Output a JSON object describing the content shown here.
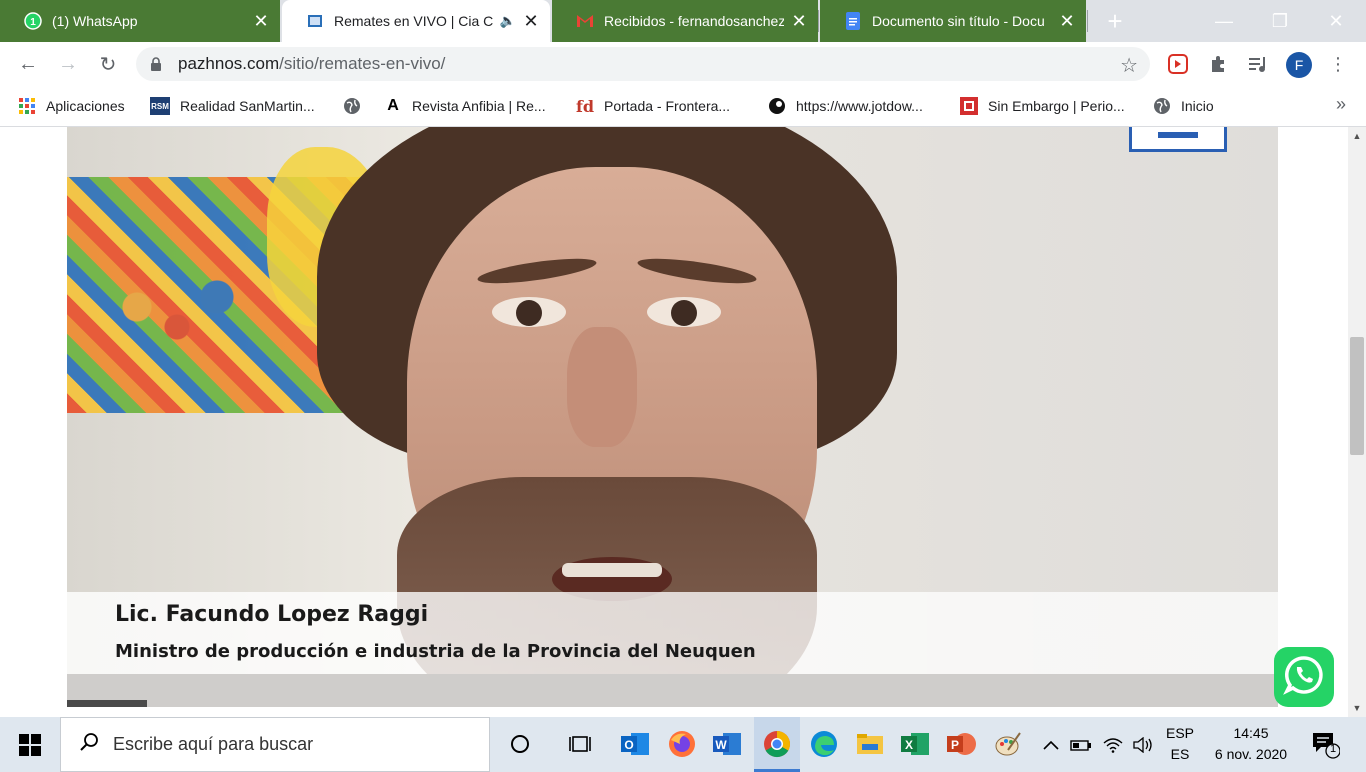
{
  "tabs": [
    {
      "title": "(1) WhatsApp",
      "icon": "whatsapp-icon"
    },
    {
      "title": "Remates en VIVO | Cia C",
      "icon": "site-icon",
      "active": true,
      "audio": true
    },
    {
      "title": "Recibidos - fernandosanchez",
      "icon": "gmail-icon"
    },
    {
      "title": "Documento sin título - Docu",
      "icon": "docs-icon"
    }
  ],
  "toolbar": {
    "url_domain": "pazhnos.com",
    "url_path": "/sitio/remates-en-vivo/",
    "profile_initial": "F"
  },
  "bookmarks": [
    {
      "label": "Aplicaciones",
      "icon": "apps-grid-icon"
    },
    {
      "label": "Realidad SanMartin...",
      "icon": "rsm-icon",
      "icon_text": "RSM"
    },
    {
      "label": "",
      "icon": "globe-icon"
    },
    {
      "label": "Revista Anfibia | Re...",
      "icon": "anfibia-icon",
      "icon_text": "A"
    },
    {
      "label": "Portada - Frontera...",
      "icon": "fd-icon",
      "icon_text": "fd"
    },
    {
      "label": "https://www.jotdow...",
      "icon": "jotdown-icon"
    },
    {
      "label": "Sin Embargo | Perio...",
      "icon": "sinembargo-icon"
    },
    {
      "label": "Inicio",
      "icon": "globe-icon"
    }
  ],
  "video": {
    "lower_third_name": "Lic. Facundo Lopez Raggi",
    "lower_third_role": "Ministro de producción e industria de la Provincia del Neuquen"
  },
  "taskbar": {
    "search_placeholder": "Escribe aquí para buscar",
    "language_top": "ESP",
    "language_bottom": "ES",
    "time": "14:45",
    "date": "6 nov. 2020",
    "notification_count": "1"
  },
  "colors": {
    "tabstrip_inactive": "#4a7a34",
    "whatsapp_green": "#25d366",
    "profile": "#1a56a6"
  }
}
